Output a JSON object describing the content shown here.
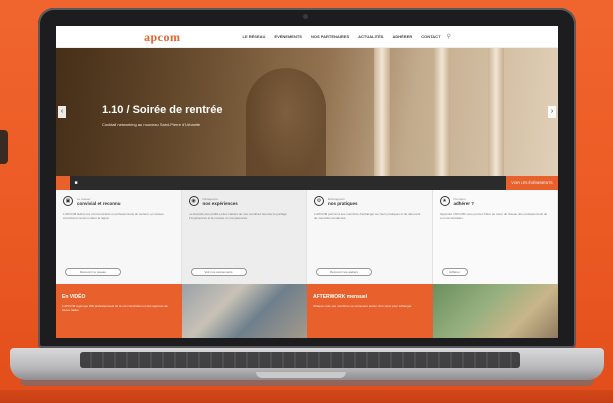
{
  "nav": {
    "logo": "apcom",
    "logo_sub": "",
    "items": [
      "Le réseau",
      "Événements",
      "Nos partenaires",
      "Actualités",
      "Adhérer",
      "Contact"
    ],
    "search_icon": "search-icon"
  },
  "hero": {
    "title": "1.10 / Soirée de rentrée",
    "subtitle": "Cocktail networking au nouveau Saint-Pierre d'Urbanite",
    "prev_icon": "chevron-left-icon",
    "next_icon": "chevron-right-icon"
  },
  "bar": {
    "cta": "Voir les événements"
  },
  "features": [
    {
      "icon": "briefcase-icon",
      "kicker": "Le réseau",
      "title": "convivial et reconnu",
      "text": "L'APCOM fédère les communicants et professionnels du secteur, en réseau convivial et reconnu dans la région.",
      "button": "Découvrir le réseau"
    },
    {
      "icon": "eye-icon",
      "kicker": "Partageons",
      "title": "nos expériences",
      "text": "La diversité des profils et des métiers de nos membres favorise le partage d'expériences et la montée en compétences.",
      "button": "Voir nos événements"
    },
    {
      "icon": "gear-icon",
      "kicker": "Échangeons",
      "title": "nos pratiques",
      "text": "L'APCOM permet à ses membres d'échanger sur leurs pratiques et de découvrir de nouvelles tendances.",
      "button": "Découvrir les ateliers"
    },
    {
      "icon": "network-icon",
      "kicker": "Pourquoi",
      "title": "adhérer ?",
      "text": "Rejoindre l'APCOM vous permet d'être au cœur du réseau des professionnels de la communication.",
      "button": "Adhérer"
    }
  ],
  "bottom": [
    {
      "style": "orange",
      "title": "En VIDÉO",
      "text": "L'APCOM regroupe 200 professionnels de la communication et des agences de toutes tailles."
    },
    {
      "style": "photo1",
      "title": "",
      "text": ""
    },
    {
      "style": "orange",
      "title": "AFTERWORK mensuel",
      "text": "Chaque mois, les membres se retrouvent autour d'un verre pour échanger."
    },
    {
      "style": "photo2",
      "title": "",
      "text": ""
    }
  ],
  "colors": {
    "accent": "#e8612c",
    "background": "#ec5a24",
    "dark": "#2b2b2b"
  }
}
